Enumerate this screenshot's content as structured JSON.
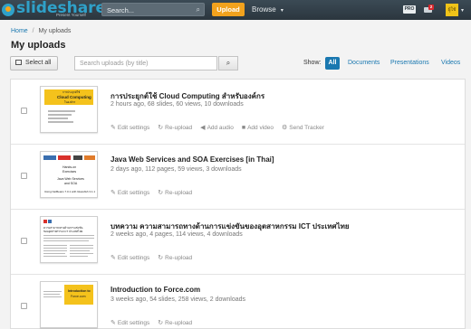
{
  "header": {
    "logo_text": "slideshare",
    "logo_tagline": "Present Yourself",
    "search_placeholder": "Search...",
    "upload_label": "Upload",
    "browse_label": "Browse",
    "pro_badge": "PRO",
    "notification_count": "2",
    "avatar_text": "ผู้ใช้",
    "colors": {
      "bar": "#2b363e",
      "brand": "#2fa1c9",
      "upload": "#f2a21d"
    }
  },
  "breadcrumb": {
    "home": "Home",
    "separator": "/",
    "current": "My uploads"
  },
  "page_title": "My uploads",
  "toolbar": {
    "select_all": "Select all",
    "filter_placeholder": "Search uploads (by title)",
    "show_label": "Show:",
    "filters": [
      "All",
      "Documents",
      "Presentations",
      "Videos"
    ],
    "active_filter": "All"
  },
  "uploads": [
    {
      "title": "การประยุกต์ใช้ Cloud Computing สำหรับองค์กร",
      "meta": "2 hours ago, 68 slides, 60 views, 10 downloads",
      "actions": [
        "Edit settings",
        "Re-upload",
        "Add audio",
        "Add video",
        "Send Tracker"
      ],
      "thumb": {
        "heading": "Cloud Computing",
        "sub": "การประยุกต์ใช้",
        "sub2": "ในองค์กร"
      }
    },
    {
      "title": "Java Web Services and SOA Exercises [in Thai]",
      "meta": "2 days ago, 112 pages, 59 views, 3 downloads",
      "actions": [
        "Edit settings",
        "Re-upload"
      ],
      "thumb": {
        "l1": "Hands-on",
        "l2": "Exercises",
        "l3": "Java Web Services",
        "l4": "and SOA",
        "l5": "Using NetBeans 7.0.1 with Glassfish 3.1.1"
      }
    },
    {
      "title": "บทความ ความสามารถทางด้านการแข่งขันของอุตสาหกรรม ICT ประเทศไทย",
      "meta": "2 weeks ago, 4 pages, 114 views, 4 downloads",
      "actions": [
        "Edit settings",
        "Re-upload"
      ],
      "thumb": {
        "l1": "ความสามารถทางด้านการแข่งขัน",
        "l2": "ของอุตสาหกรรม ICT ประเทศไทย"
      }
    },
    {
      "title": "Introduction to Force.com",
      "meta": "3 weeks ago, 54 slides, 258 views, 2 downloads",
      "actions": [
        "Edit settings",
        "Re-upload"
      ],
      "thumb": {
        "heading": "Introduction to",
        "sub": "Force.com"
      }
    }
  ]
}
